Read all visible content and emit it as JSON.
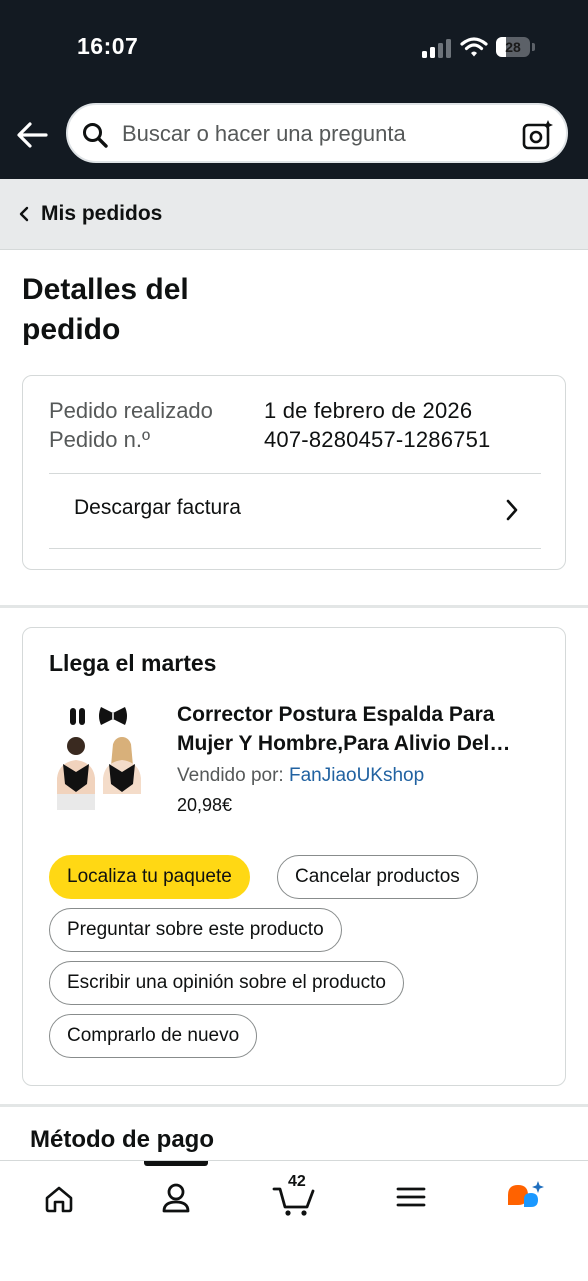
{
  "status_bar": {
    "time": "16:07",
    "battery_level": "28",
    "battery_fraction": 0.28,
    "icons": [
      "signal-icon",
      "wifi-icon",
      "battery-icon"
    ]
  },
  "search": {
    "placeholder": "Buscar o hacer una pregunta",
    "icons": [
      "back-arrow-icon",
      "search-icon",
      "camera-lens-icon"
    ]
  },
  "breadcrumb": {
    "label": "Mis pedidos"
  },
  "page": {
    "title": "Detalles del pedido"
  },
  "order_summary": {
    "rows": [
      {
        "label": "Pedido realizado",
        "value": "1 de febrero de 2026"
      },
      {
        "label": "Pedido n.º",
        "value": "407-8280457-1286751"
      }
    ],
    "invoice_label": "Descargar factura"
  },
  "delivery": {
    "heading": "Llega el martes",
    "product": {
      "title": "Corrector Postura Espalda Para Mujer Y Hombre,Para Alivio Del Dolor De Espalda",
      "seller_prefix": "Vendido por: ",
      "seller_name": "FanJiaoUKshop",
      "price": "20,98€"
    },
    "actions": {
      "track": "Localiza tu paquete",
      "cancel": "Cancelar productos",
      "ask": "Preguntar sobre este producto",
      "review": "Escribir una opinión sobre el producto",
      "buy_again": "Comprarlo de nuevo"
    }
  },
  "payment": {
    "heading": "Método de pago"
  },
  "bottom_nav": {
    "items": [
      "home-icon",
      "account-icon",
      "cart-icon",
      "menu-icon",
      "rufus-icon"
    ],
    "cart_count": "42",
    "active": "account-icon"
  },
  "colors": {
    "header_bg": "#131a22",
    "primary_button": "#ffd814",
    "link": "#2162a1",
    "rufus_orange": "#ff6200",
    "rufus_blue": "#1a98ff"
  }
}
